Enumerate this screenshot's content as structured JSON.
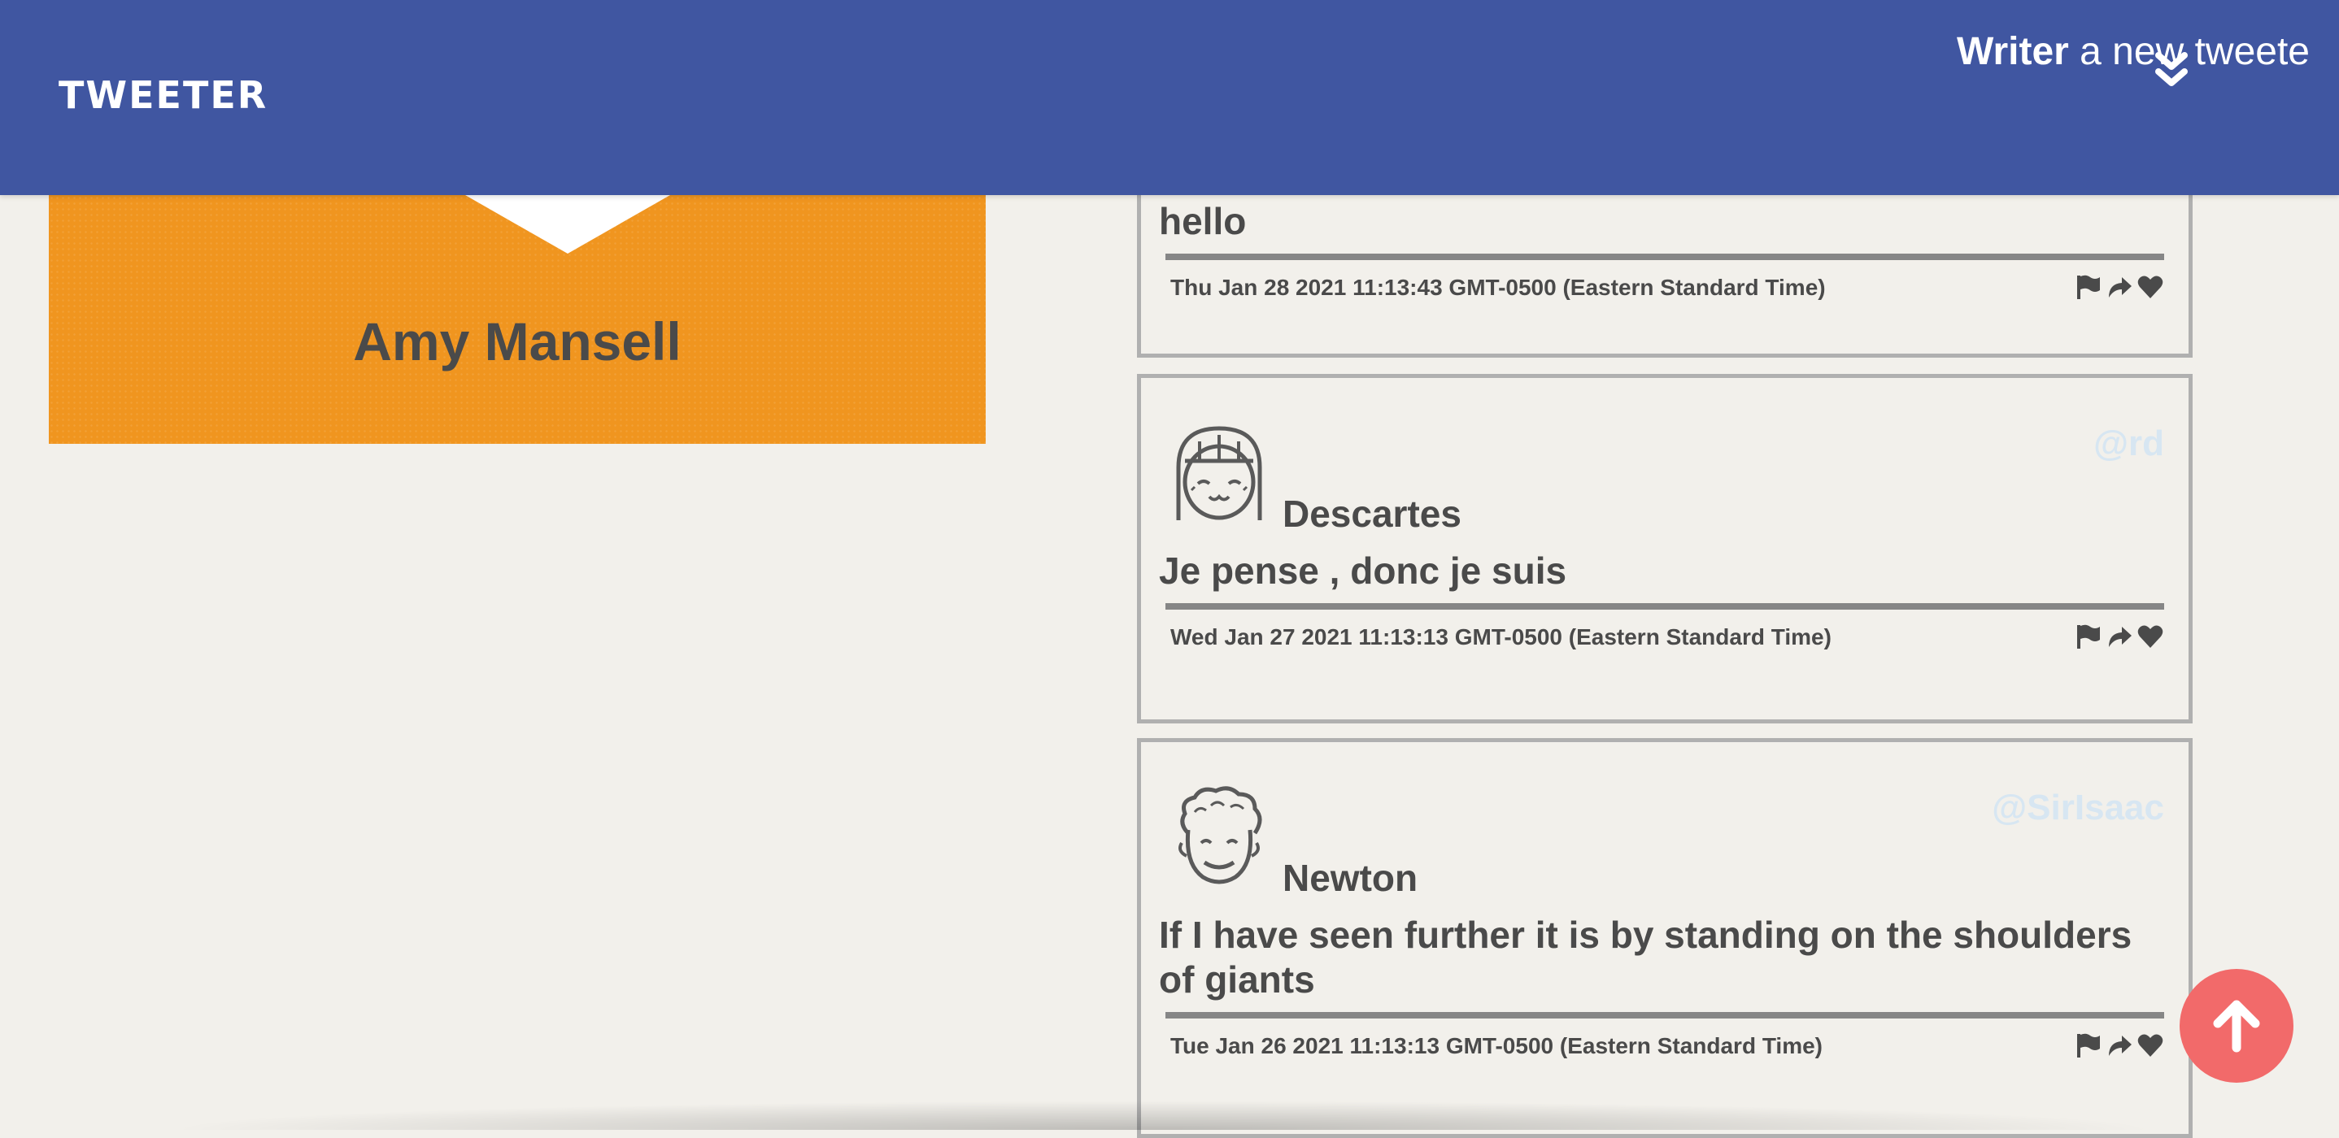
{
  "nav": {
    "logo": "TWEETER",
    "compose_strong": "Writer",
    "compose_rest": " a new tweete",
    "compose_icon": "double-chevron-down-icon"
  },
  "profile": {
    "name": "Amy Mansell"
  },
  "tweets": [
    {
      "name": "",
      "handle": "",
      "content": "hello",
      "date": "Thu Jan 28 2021 11:13:43 GMT-0500 (Eastern Standard Time)"
    },
    {
      "name": "Descartes",
      "handle": "@rd",
      "content": "Je pense , donc je suis",
      "date": "Wed Jan 27 2021 11:13:13 GMT-0500 (Eastern Standard Time)"
    },
    {
      "name": "Newton",
      "handle": "@SirIsaac",
      "content": "If I have seen further it is by standing on the shoulders of giants",
      "date": "Tue Jan 26 2021 11:13:13 GMT-0500 (Eastern Standard Time)"
    }
  ],
  "actions": [
    "flag-icon",
    "retweet-icon",
    "heart-icon"
  ],
  "colors": {
    "nav": "#4056a1",
    "profile": "#f0951f",
    "scroll_button": "#f26a6a",
    "handle": "#d7e6f2"
  }
}
